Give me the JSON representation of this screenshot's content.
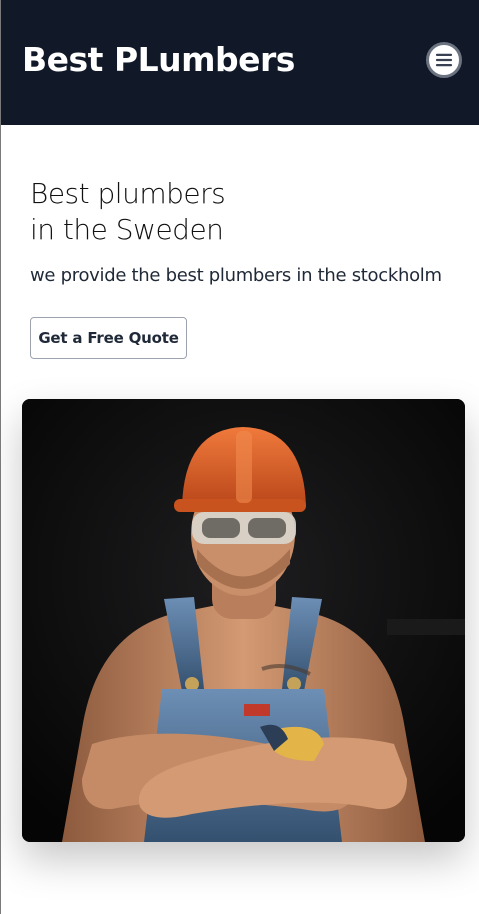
{
  "header": {
    "brand": "Best PLumbers",
    "menu_icon": "hamburger-icon",
    "background": "#111827"
  },
  "hero": {
    "title_line1": "Best plumbers",
    "title_line2": "in the Sweden",
    "subtitle": "we provide the best plumbers in the stockholm",
    "cta_label": "Get a Free Quote"
  },
  "image": {
    "subject": "plumber-photo",
    "colors": {
      "helmet": "#e0632c",
      "overalls": "#5b7fa6",
      "skin": "#c98f6a",
      "background": "#0a0a0a"
    }
  }
}
